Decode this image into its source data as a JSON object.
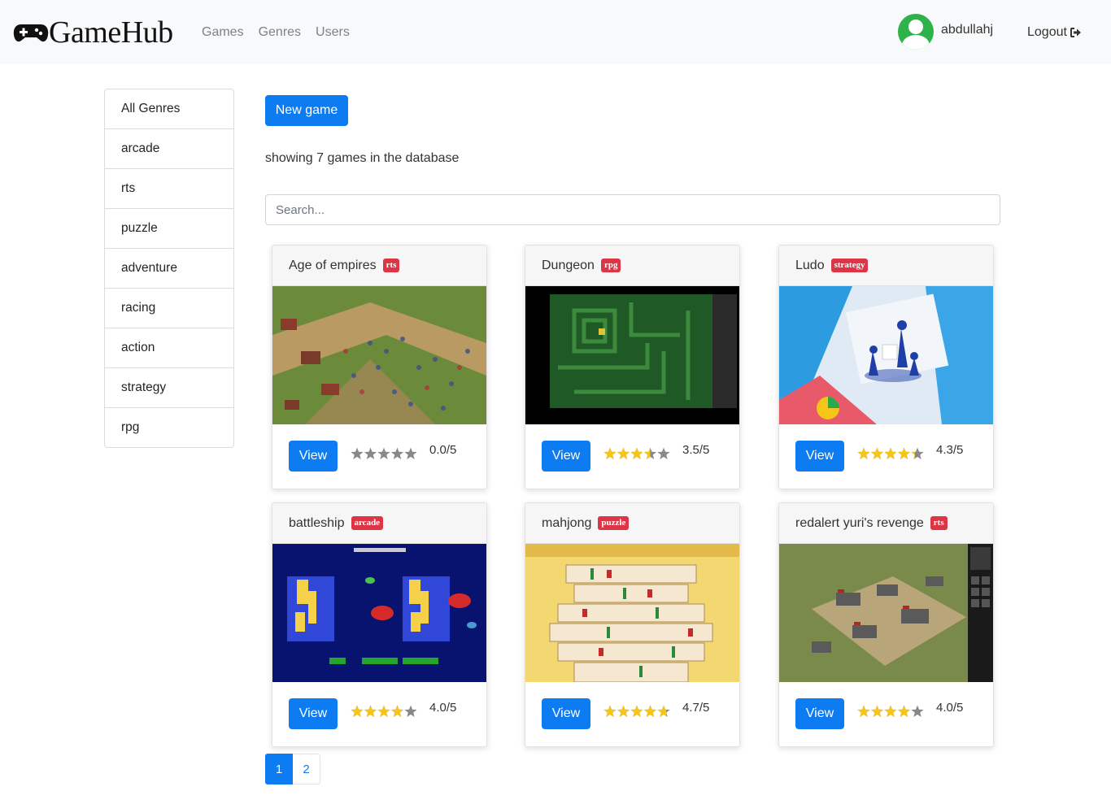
{
  "navbar": {
    "brand": "GameHub",
    "links": [
      "Games",
      "Genres",
      "Users"
    ],
    "username": "abdullahj",
    "logout": "Logout"
  },
  "sidebar": {
    "genres": [
      "All Genres",
      "arcade",
      "rts",
      "puzzle",
      "adventure",
      "racing",
      "action",
      "strategy",
      "rpg"
    ]
  },
  "main": {
    "new_game_label": "New game",
    "count_text": "showing 7 games in the database",
    "search_placeholder": "Search..."
  },
  "cards": [
    {
      "title": "Age of empires",
      "genre": "rts",
      "view_label": "View",
      "rating_value": 0.0,
      "rating_text": "0.0/5"
    },
    {
      "title": "Dungeon",
      "genre": "rpg",
      "view_label": "View",
      "rating_value": 3.5,
      "rating_text": "3.5/5"
    },
    {
      "title": "Ludo",
      "genre": "strategy",
      "view_label": "View",
      "rating_value": 4.3,
      "rating_text": "4.3/5"
    },
    {
      "title": "battleship",
      "genre": "arcade",
      "view_label": "View",
      "rating_value": 4.0,
      "rating_text": "4.0/5"
    },
    {
      "title": "mahjong",
      "genre": "puzzle",
      "view_label": "View",
      "rating_value": 4.7,
      "rating_text": "4.7/5"
    },
    {
      "title": "redalert yuri's revenge",
      "genre": "rts",
      "view_label": "View",
      "rating_value": 4.0,
      "rating_text": "4.0/5"
    }
  ],
  "pagination": {
    "pages": [
      "1",
      "2"
    ],
    "current": "1"
  },
  "colors": {
    "primary": "#0d7cf2",
    "badge": "#dc3545",
    "star_on": "#f5c518",
    "star_off": "#888888",
    "avatar": "#2db34a"
  }
}
